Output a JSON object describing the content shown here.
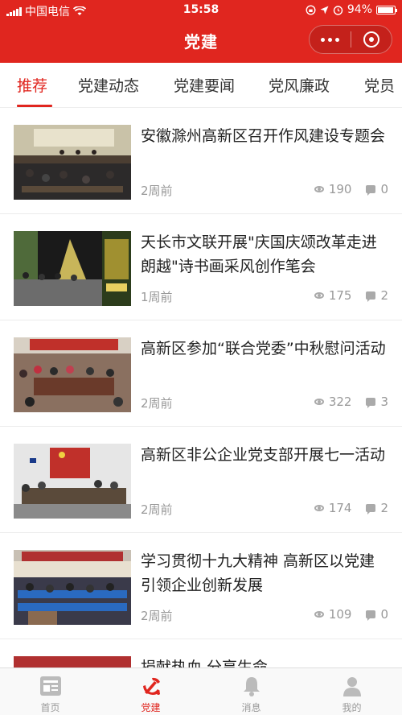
{
  "status_bar": {
    "carrier": "中国电信",
    "time": "15:58",
    "battery": "94%",
    "battery_level": 0.94
  },
  "nav": {
    "title": "党建"
  },
  "tabs": [
    {
      "label": "推荐",
      "active": true
    },
    {
      "label": "党建动态",
      "active": false
    },
    {
      "label": "党建要闻",
      "active": false
    },
    {
      "label": "党风廉政",
      "active": false
    },
    {
      "label": "党员",
      "active": false
    }
  ],
  "articles": [
    {
      "title": "安徽滁州高新区召开作风建设专题会",
      "time": "2周前",
      "views": "190",
      "comments": "0",
      "thumb": "meeting-hall"
    },
    {
      "title": "天长市文联开展\"庆国庆颂改革走进朗越\"诗书画采风创作笔会",
      "time": "1周前",
      "views": "175",
      "comments": "2",
      "thumb": "exhibition"
    },
    {
      "title": "高新区参加“联合党委”中秋慰问活动",
      "time": "2周前",
      "views": "322",
      "comments": "3",
      "thumb": "conference-room"
    },
    {
      "title": "高新区非公企业党支部开展七一活动",
      "time": "2周前",
      "views": "174",
      "comments": "2",
      "thumb": "party-meeting"
    },
    {
      "title": "学习贯彻十九大精神 高新区以党建引领企业创新发展",
      "time": "2周前",
      "views": "109",
      "comments": "0",
      "thumb": "lecture-hall"
    },
    {
      "title": "捐献热血 分享生命",
      "time": "",
      "views": "",
      "comments": "",
      "thumb": "blood-donation"
    }
  ],
  "tabbar": [
    {
      "label": "首页",
      "icon": "news-icon",
      "active": false
    },
    {
      "label": "党建",
      "icon": "party-emblem-icon",
      "active": true
    },
    {
      "label": "消息",
      "icon": "bell-icon",
      "active": false
    },
    {
      "label": "我的",
      "icon": "user-icon",
      "active": false
    }
  ],
  "colors": {
    "accent": "#e0261f",
    "muted": "#999999"
  }
}
